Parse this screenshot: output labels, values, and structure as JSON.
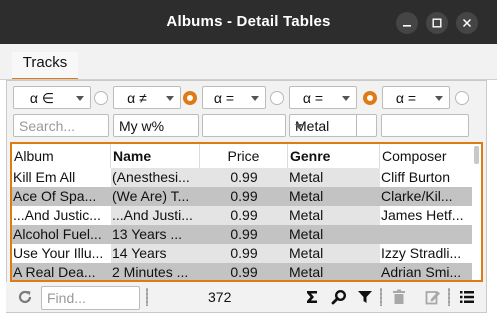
{
  "window": {
    "title": "Albums - Detail Tables"
  },
  "tabs": [
    {
      "label": "Tracks",
      "active": true
    }
  ],
  "filters": {
    "operators": [
      "α ∈",
      "α ≠",
      "α =",
      "α =",
      "α ="
    ],
    "radios_selected": [
      false,
      true,
      false,
      true,
      false
    ],
    "inputs": [
      {
        "value": "",
        "placeholder": "Search..."
      },
      {
        "value": "My w%",
        "placeholder": ""
      },
      {
        "value": "",
        "placeholder": ""
      },
      {
        "value": "Metal",
        "placeholder": "",
        "dropdown": true
      },
      {
        "value": "",
        "placeholder": ""
      }
    ]
  },
  "table": {
    "columns": [
      {
        "label": "Album",
        "bold": false
      },
      {
        "label": "Name",
        "bold": true
      },
      {
        "label": "Price",
        "bold": false
      },
      {
        "label": "Genre",
        "bold": true
      },
      {
        "label": "Composer",
        "bold": false
      }
    ],
    "rows": [
      [
        "Kill Em All",
        "(Anesthesi...",
        "0.99",
        "Metal",
        "Cliff Burton"
      ],
      [
        "Ace Of Spa...",
        "(We Are) T...",
        "0.99",
        "Metal",
        "Clarke/Kil..."
      ],
      [
        "...And Justic...",
        "...And Justi...",
        "0.99",
        "Metal",
        "James Hetf..."
      ],
      [
        "Alcohol Fuel...",
        "13 Years ...",
        "0.99",
        "Metal",
        ""
      ],
      [
        "Use Your Illu...",
        "14 Years",
        "0.99",
        "Metal",
        "Izzy Stradli..."
      ],
      [
        "A Real Dea...",
        "2 Minutes ...",
        "0.99",
        "Metal",
        "Adrian Smi..."
      ]
    ]
  },
  "bottombar": {
    "find_placeholder": "Find...",
    "record_count": "372",
    "icons": [
      "refresh-icon",
      "sigma-icon",
      "search-icon",
      "filter-icon",
      "delete-icon",
      "edit-icon",
      "list-icon"
    ]
  },
  "colors": {
    "accent": "#e07a14",
    "titlebar": "#2d2d2d",
    "row_shade": "#c3c3c3",
    "row_light": "#e4e4e4"
  }
}
